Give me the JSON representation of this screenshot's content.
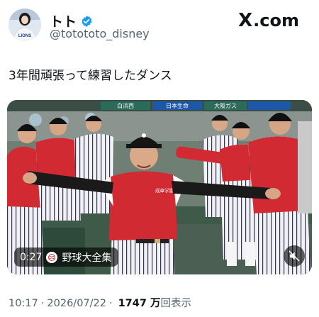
{
  "author": {
    "display_name": "トト",
    "handle": "@totototo_disney",
    "verified": true,
    "avatar_icon": "profile-photo",
    "avatar_jersey_text": "LIONS"
  },
  "brand": {
    "icon": "x-logo",
    "label": "X",
    "suffix": ".com"
  },
  "tweet": {
    "text": "3年間頑張って練習したダンス"
  },
  "media": {
    "type": "video",
    "duration": "0:27",
    "source_label": "野球大全集",
    "mute_icon": "speaker-muted-icon",
    "banner_texts": [
      "白浜西",
      "日本生命",
      "大阪ガス"
    ],
    "jersey_text": "成章学園"
  },
  "meta": {
    "time": "10:17",
    "separator": "·",
    "date": "2026/07/22",
    "views_count": "1747 万",
    "views_label": "回表示"
  },
  "colors": {
    "text": "#0f1419",
    "muted": "#536471",
    "verified": "#1d9bf0",
    "jersey_red": "#d22a33"
  }
}
